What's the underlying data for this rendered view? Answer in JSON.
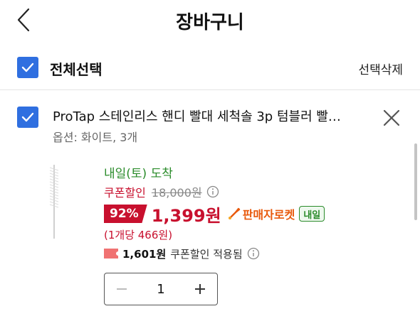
{
  "header": {
    "title": "장바구니",
    "back_icon": "chevron-left-icon"
  },
  "select_all": {
    "label": "전체선택",
    "checked": true,
    "delete_selected_label": "선택삭제"
  },
  "cart_item": {
    "checked": true,
    "name": "ProTap 스테인리스 핸디 빨대 세척솔 3p 텀블러 빨…",
    "option": "옵션: 화이트, 3개",
    "delivery": "내일(토) 도착",
    "coupon_discount_label": "쿠폰할인",
    "original_price": "18,000원",
    "discount_percent": "92%",
    "final_price": "1,399원",
    "seller_badge": "판매자로켓",
    "tomorrow_badge": "내일",
    "unit_price": "(1개당 466원)",
    "coupon_amount": "1,601원",
    "coupon_applied_label": "쿠폰할인 적용됨",
    "quantity": "1"
  },
  "colors": {
    "accent_blue": "#2f6fe0",
    "discount_red": "#c8102e",
    "delivery_green": "#2a8b2a",
    "rocket_orange": "#e8590c"
  }
}
